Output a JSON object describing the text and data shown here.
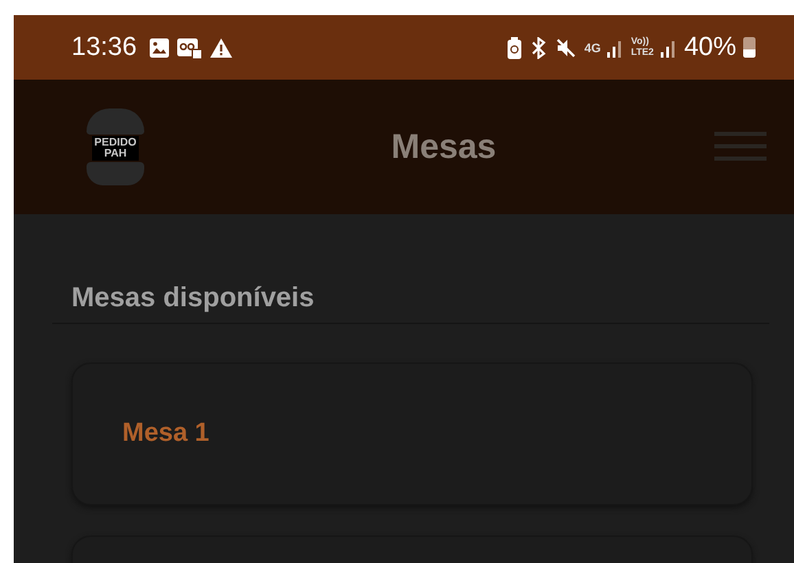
{
  "status_bar": {
    "time": "13:36",
    "network_1": "4G",
    "network_2": "Vo))",
    "network_2b": "LTE2",
    "battery": "40%"
  },
  "header": {
    "logo_line_1": "PEDIDO",
    "logo_line_2": "PAH",
    "title": "Mesas"
  },
  "section": {
    "title": "Mesas disponíveis"
  },
  "tables": [
    {
      "kind": "labeled",
      "label": "Mesa 1"
    },
    {
      "kind": "blank"
    }
  ]
}
